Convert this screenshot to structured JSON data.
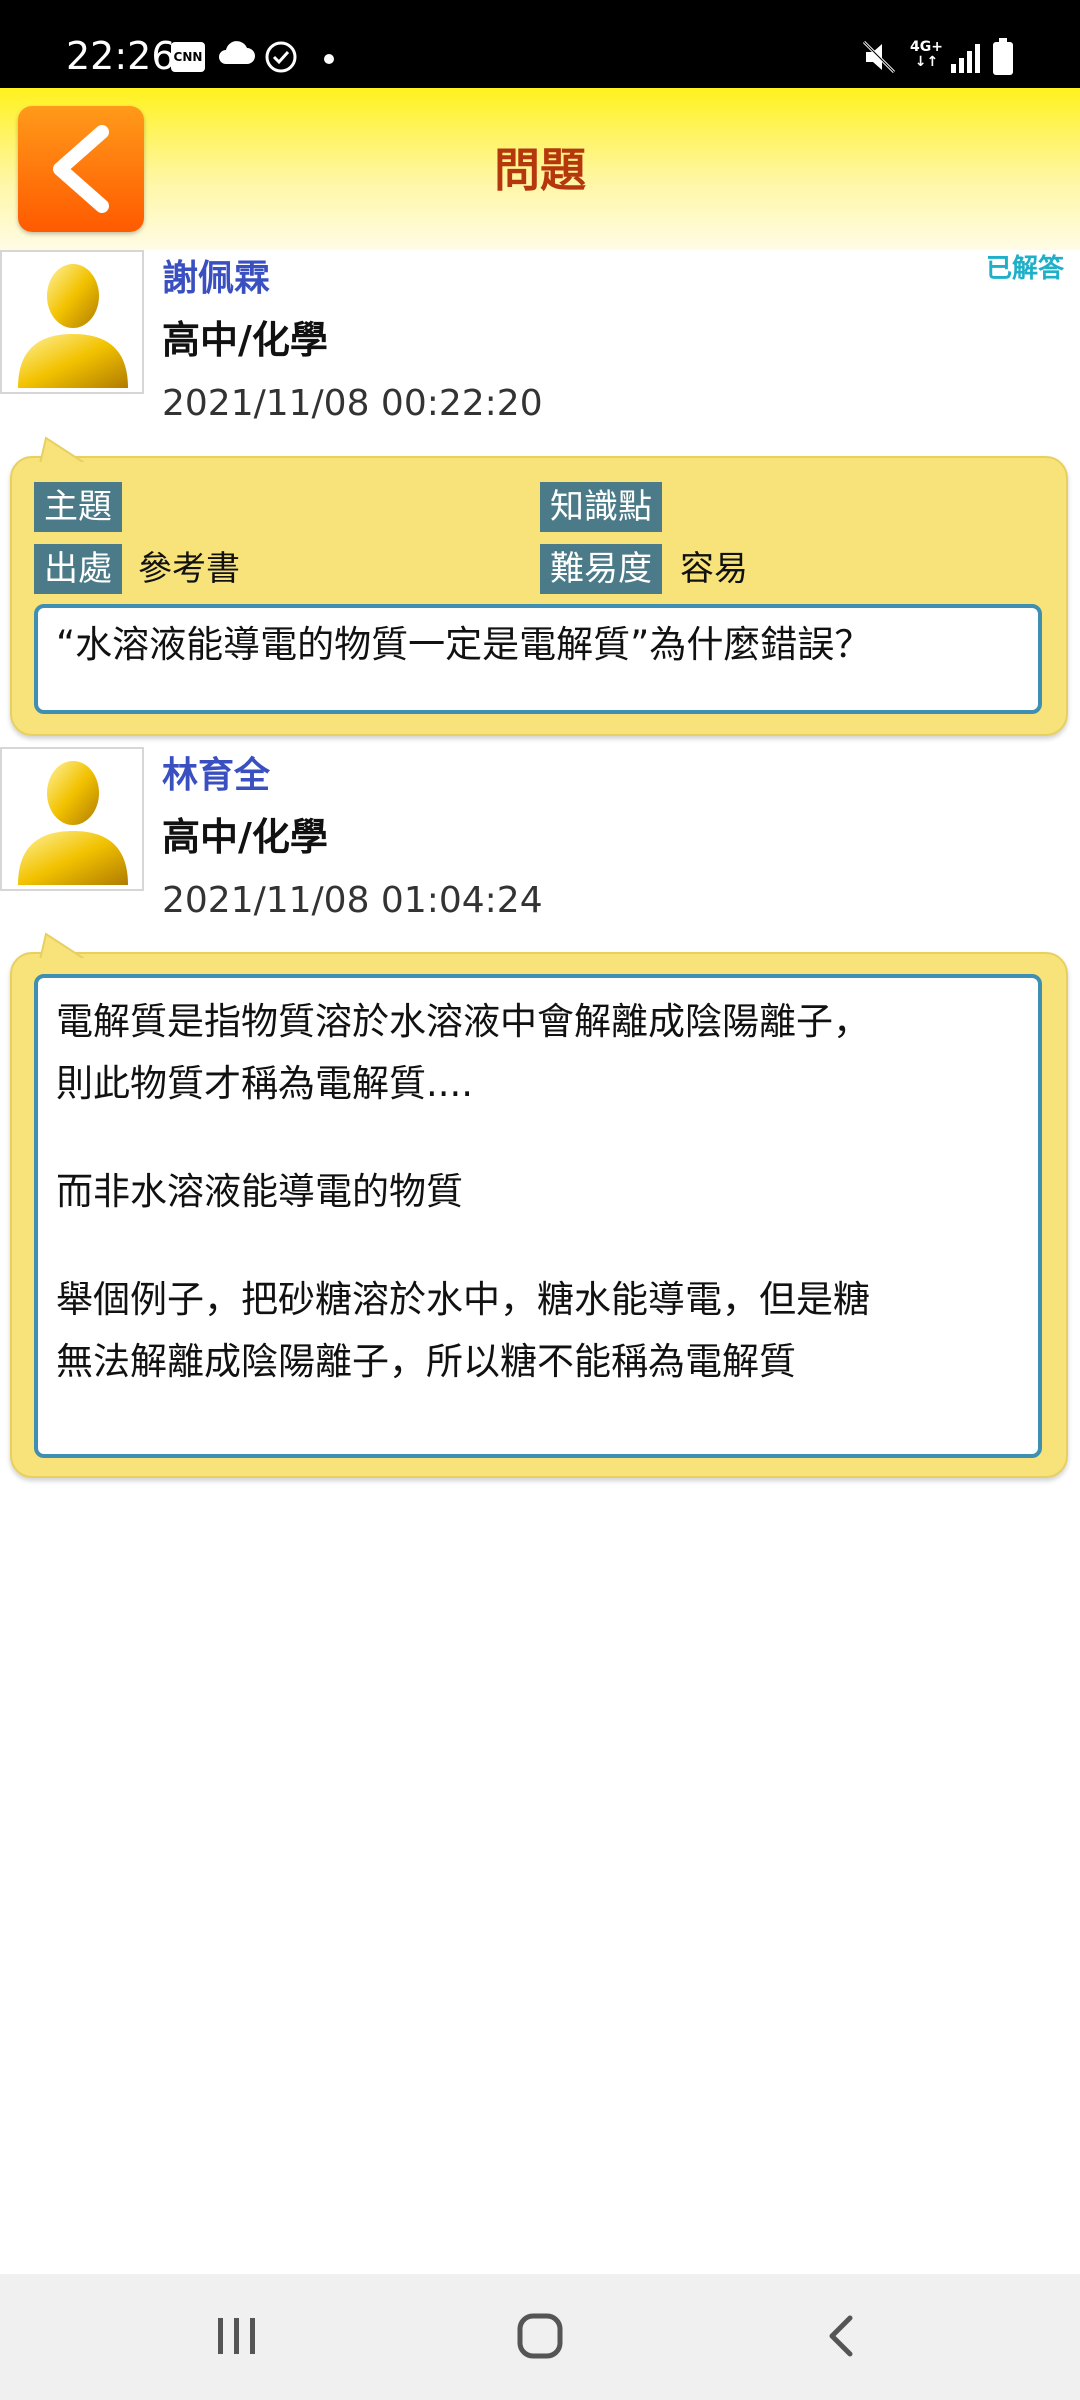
{
  "status_bar": {
    "time": "22:26",
    "cnn_badge": "CNN",
    "network": "4G+",
    "icons": [
      "cnn-icon",
      "cloud-icon",
      "check-circle-icon",
      "notification-dot",
      "mute-icon",
      "signal-icon",
      "battery-icon"
    ]
  },
  "header": {
    "title": "問題",
    "back_icon": "chevron-left-icon"
  },
  "question": {
    "author": "謝佩霖",
    "subject": "高中/化學",
    "time": "2021/11/08 00:22:20",
    "status": "已解答",
    "tags": {
      "topic_label": "主題",
      "topic_value": "",
      "knowledge_label": "知識點",
      "knowledge_value": "",
      "source_label": "出處",
      "source_value": "參考書",
      "difficulty_label": "難易度",
      "difficulty_value": "容易"
    },
    "text": "“水溶液能導電的物質一定是電解質”為什麼錯誤？"
  },
  "answer": {
    "author": "林育全",
    "subject": "高中/化學",
    "time": "2021/11/08 01:04:24",
    "paragraphs": [
      "電解質是指物質溶於水溶液中會解離成陰陽離子，",
      "則此物質才稱為電解質....",
      "而非水溶液能導電的物質",
      "舉個例子，把砂糖溶於水中，糖水能導電，但是糖",
      "無法解離成陰陽離子，所以糖不能稱為電解質"
    ]
  },
  "colors": {
    "header_yellow": "#fff21e",
    "back_button_orange": "#ff7a00",
    "title_red": "#b5370e",
    "author_blue": "#3a4fc0",
    "answered_cyan": "#1fb0c8",
    "bubble_yellow": "#f7e37a",
    "tag_teal": "#4b7b88",
    "content_border": "#3f8fb2"
  }
}
